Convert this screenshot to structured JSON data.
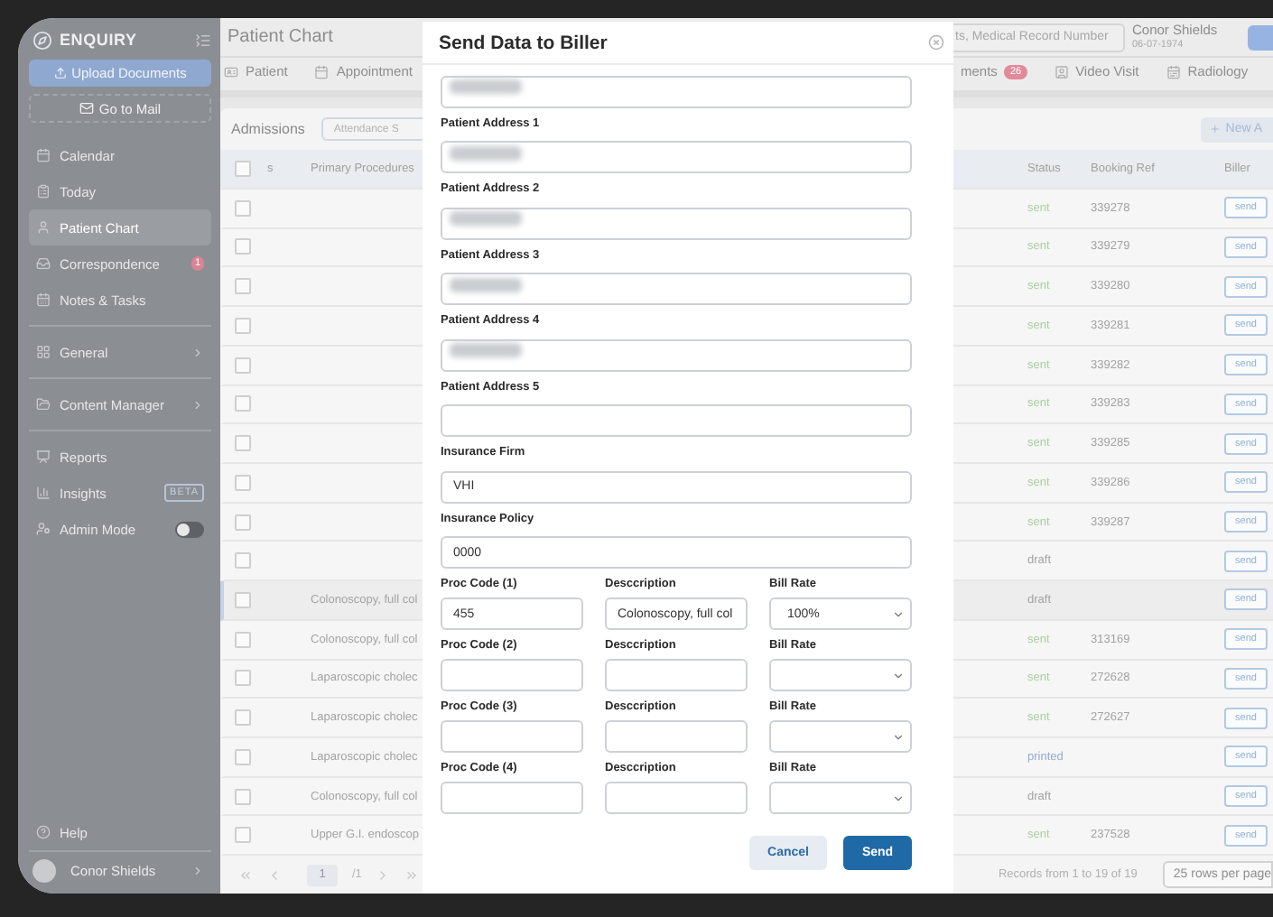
{
  "sidebar": {
    "logo": "ENQUIRY",
    "upload_button": "Upload Documents",
    "mail_button": "Go to Mail",
    "sections": [
      {
        "items": [
          {
            "label": "Calendar",
            "kind": "link",
            "selected": false
          },
          {
            "label": "Today",
            "kind": "link",
            "selected": false
          },
          {
            "label": "Patient Chart",
            "kind": "link",
            "selected": true
          },
          {
            "label": "Correspondence",
            "kind": "link",
            "selected": false,
            "badge": "1"
          },
          {
            "label": "Notes & Tasks",
            "kind": "link",
            "selected": false
          }
        ]
      },
      {
        "items": [
          {
            "label": "General",
            "kind": "submenu",
            "selected": false
          }
        ]
      },
      {
        "items": [
          {
            "label": "Content Manager",
            "kind": "submenu",
            "selected": false
          }
        ]
      },
      {
        "items": [
          {
            "label": "Reports",
            "kind": "link",
            "selected": false
          },
          {
            "label": "Insights",
            "kind": "tag",
            "tag": "BETA",
            "selected": false
          },
          {
            "label": "Admin Mode",
            "kind": "toggle",
            "on": false,
            "selected": false
          }
        ]
      }
    ],
    "help": "Help",
    "user": "Conor Shields"
  },
  "header": {
    "title": "Patient Chart",
    "search": {
      "placeholder": "ts, Medical Record Number"
    },
    "patient": {
      "name": "Conor Shields",
      "dob": "06-07-1974"
    }
  },
  "tabs": [
    {
      "label": "Patient",
      "selected": false
    },
    {
      "label": "Appointment",
      "selected": false
    },
    {
      "label": "ments",
      "badge": "26",
      "selected": false
    },
    {
      "label": "Video Visit",
      "selected": false
    },
    {
      "label": "Radiology",
      "selected": false
    }
  ],
  "admissions": {
    "title": "Admissions",
    "filter": "Attendance S",
    "new_button": "New A"
  },
  "table": {
    "all_checked": false,
    "columns": [
      "s",
      "Primary Procedures",
      "Status",
      "Booking Ref",
      "Biller"
    ],
    "rows": [
      {
        "checked": false,
        "selected": false,
        "status": "sent",
        "color": "#a9cf9f",
        "booking_ref": "339278",
        "biller": "send"
      },
      {
        "checked": false,
        "selected": false,
        "status": "sent",
        "color": "#a9cf9f",
        "booking_ref": "339279",
        "biller": "send"
      },
      {
        "checked": false,
        "selected": false,
        "status": "sent",
        "color": "#a9cf9f",
        "booking_ref": "339280",
        "biller": "send"
      },
      {
        "checked": false,
        "selected": false,
        "status": "sent",
        "color": "#a9cf9f",
        "booking_ref": "339281",
        "biller": "send"
      },
      {
        "checked": false,
        "selected": false,
        "status": "sent",
        "color": "#a9cf9f",
        "booking_ref": "339282",
        "biller": "send"
      },
      {
        "checked": false,
        "selected": false,
        "status": "sent",
        "color": "#a9cf9f",
        "booking_ref": "339283",
        "biller": "send"
      },
      {
        "checked": false,
        "selected": false,
        "status": "sent",
        "color": "#a9cf9f",
        "booking_ref": "339285",
        "biller": "send"
      },
      {
        "checked": false,
        "selected": false,
        "status": "sent",
        "color": "#a9cf9f",
        "booking_ref": "339286",
        "biller": "send"
      },
      {
        "checked": false,
        "selected": false,
        "status": "sent",
        "color": "#a9cf9f",
        "booking_ref": "339287",
        "biller": "send"
      },
      {
        "checked": false,
        "selected": false,
        "status": "draft",
        "color": "#a3a3a3",
        "biller": "send"
      },
      {
        "checked": false,
        "selected": true,
        "procedure": "Colonoscopy, full col",
        "status": "draft",
        "color": "#a3a3a3",
        "biller": "send"
      },
      {
        "checked": false,
        "selected": false,
        "procedure": "Colonoscopy, full col",
        "status": "sent",
        "color": "#a9cf9f",
        "booking_ref": "313169",
        "biller": "send"
      },
      {
        "checked": false,
        "selected": false,
        "procedure": "Laparoscopic cholec",
        "status": "sent",
        "color": "#a9cf9f",
        "booking_ref": "272628",
        "biller": "send"
      },
      {
        "checked": false,
        "selected": false,
        "procedure": "Laparoscopic cholec",
        "status": "sent",
        "color": "#a9cf9f",
        "booking_ref": "272627",
        "biller": "send"
      },
      {
        "checked": false,
        "selected": false,
        "procedure": "Laparoscopic cholec",
        "status": "printed",
        "color": "#93acd0",
        "biller": "send"
      },
      {
        "checked": false,
        "selected": false,
        "procedure": "Colonoscopy, full col",
        "status": "draft",
        "color": "#a3a3a3",
        "biller": "send"
      },
      {
        "checked": false,
        "selected": false,
        "procedure": "Upper G.I. endoscop",
        "status": "sent",
        "color": "#a9cf9f",
        "booking_ref": "237528",
        "biller": "send"
      }
    ]
  },
  "footer": {
    "page": "1",
    "total": "/1",
    "records": "Records from 1 to 19 of 19",
    "rows_per_page": "25 rows per page"
  },
  "modal": {
    "title": "Send Data to Biller",
    "fields": [
      {
        "blurred": true
      },
      {
        "label": "Patient Address 1",
        "blurred": true
      },
      {
        "label": "Patient Address 2",
        "blurred": true
      },
      {
        "label": "Patient Address 3",
        "blurred": true
      },
      {
        "label": "Patient Address 4",
        "blurred": true
      },
      {
        "label": "Patient Address 5",
        "blurred": false
      },
      {
        "label": "Insurance Firm",
        "value": "VHI",
        "blurred": false
      },
      {
        "label": "Insurance Policy",
        "value": "0000",
        "blurred": false
      }
    ],
    "procedures": [
      {
        "code_label": "Proc Code (1)",
        "code": "455",
        "description_label": "Desccription",
        "description": "Colonoscopy, full col",
        "rate_label": "Bill Rate",
        "rate": "100%"
      },
      {
        "code_label": "Proc Code (2)",
        "description_label": "Desccription",
        "rate_label": "Bill Rate"
      },
      {
        "code_label": "Proc Code (3)",
        "description_label": "Desccription",
        "rate_label": "Bill Rate"
      },
      {
        "code_label": "Proc Code (4)",
        "description_label": "Desccription",
        "rate_label": "Bill Rate"
      }
    ],
    "cancel_button": "Cancel",
    "send_button": "Send"
  }
}
